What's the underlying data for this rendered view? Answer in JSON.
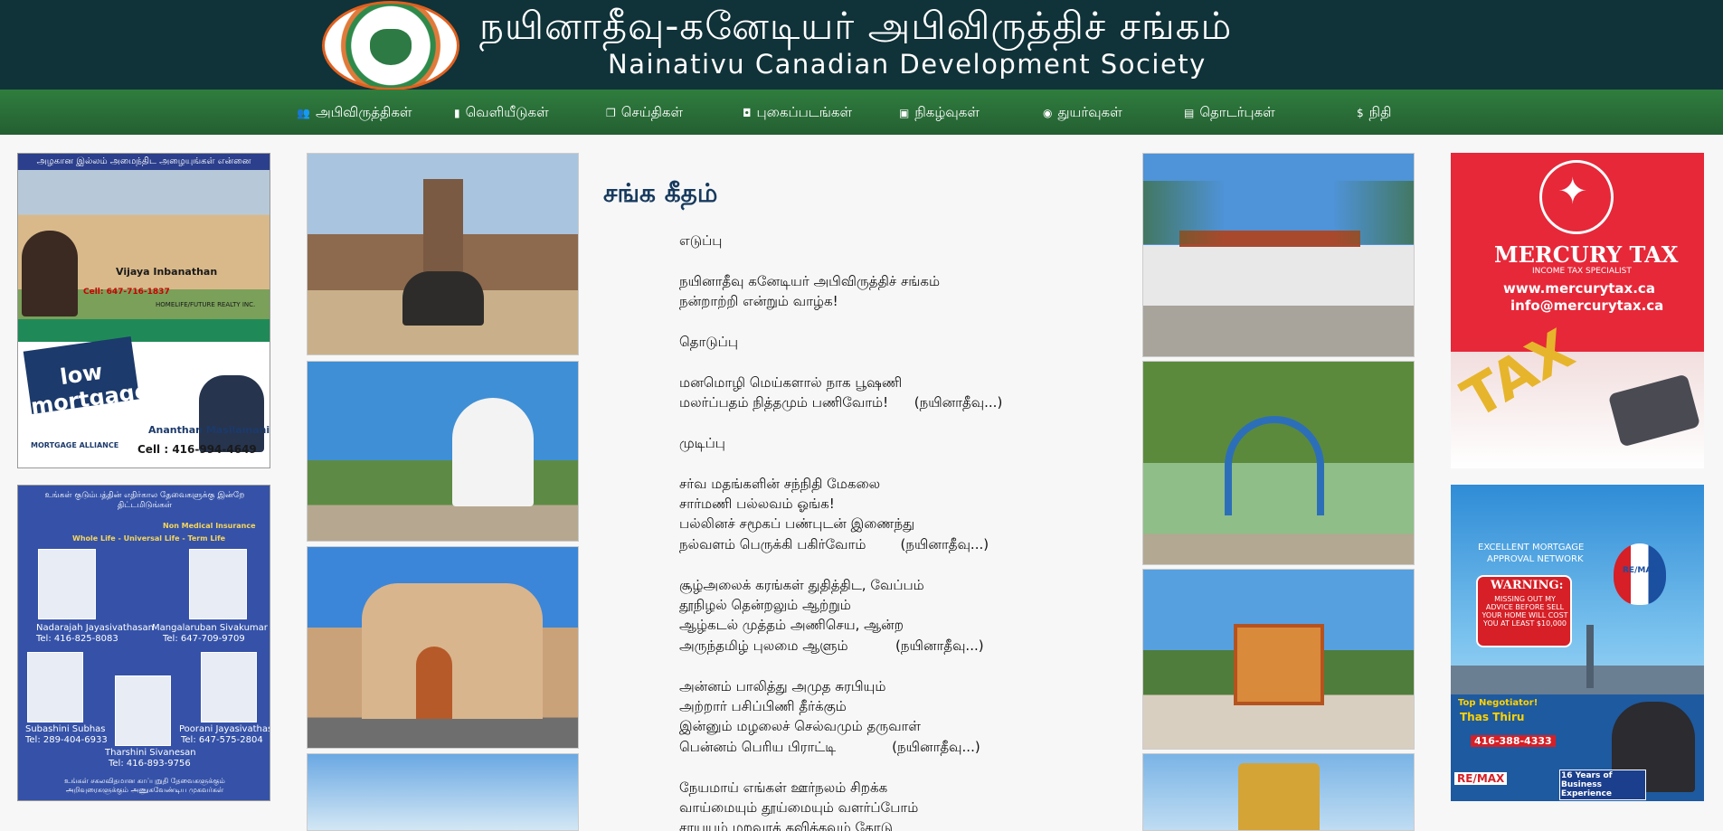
{
  "header": {
    "title_tamil": "நயினாதீவு-கனேடியர் அபிவிருத்திச் சங்கம்",
    "title_english": "Nainativu Canadian Development Society"
  },
  "nav": {
    "items": [
      {
        "icon": "users-icon",
        "label": "அபிவிருத்திகள்"
      },
      {
        "icon": "book-icon",
        "label": "வெளியீடுகள்"
      },
      {
        "icon": "news-icon",
        "label": "செய்திகள்"
      },
      {
        "icon": "camera-icon",
        "label": "புகைப்படங்கள்"
      },
      {
        "icon": "calendar-icon",
        "label": "நிகழ்வுகள்"
      },
      {
        "icon": "eye-icon",
        "label": "துயர்வுகள்"
      },
      {
        "icon": "contact-card-icon",
        "label": "தொடர்புகள்"
      },
      {
        "icon": "dollar-icon",
        "label": "நிதி"
      }
    ]
  },
  "ads": {
    "left_top": {
      "banner": "அழகான இல்லம் அமைந்திட அழையுங்கள் என்னை",
      "agent1_name": "Vijaya Inbanathan",
      "realty": "HOMELIFE/FUTURE REALTY INC.",
      "cell1": "Cell: 647-716-1837",
      "rates_text": "low mortgage RATES",
      "agent2_name": "Ananthan Masilamani",
      "cell2": "Cell : 416-994-4649",
      "brand": "MORTGAGE ALLIANCE"
    },
    "left_bottom": {
      "banner": "உங்கள் குடும்பத்தின் எதிர்கால தேவைகளுக்கு இன்றே திட்டமிடுங்கள்",
      "tagline": "Non Medical Insurance",
      "tagline2": "Whole Life - Universal Life - Term Life",
      "people": [
        {
          "name": "Nadarajah Jayasivathasan",
          "tel": "Tel: 416-825-8083"
        },
        {
          "name": "Mangalaruban Sivakumar",
          "tel": "Tel: 647-709-9709"
        },
        {
          "name": "Subashini Subhas",
          "tel": "Tel: 289-404-6933"
        },
        {
          "name": "Poorani Jayasivathasan",
          "tel": "Tel: 647-575-2804"
        },
        {
          "name": "Tharshini Sivanesan",
          "tel": "Tel: 416-893-9756"
        }
      ],
      "footer": "உங்கள் சகலவிதமான காப்புறுதி தேவைகளுக்கும் அறிவுரைகளுக்கும் அணுகவேண்டிய முகவர்கள்"
    },
    "right_top": {
      "brand": "MERCURY TAX",
      "sub": "INCOME TAX SPECIALIST",
      "web": "www.mercurytax.ca",
      "email": "info@mercurytax.ca",
      "art": "TAX"
    },
    "right_bottom": {
      "headline1": "EXCELLENT MORTGAGE",
      "headline2": "APPROVAL NETWORK",
      "warning_title": "WARNING:",
      "warning_text": "MISSING OUT MY ADVICE BEFORE SELL YOUR HOME WILL COST YOU AT LEAST $10,000",
      "top_neg": "Top Negotiator!",
      "agent": "Thas Thiru",
      "phone": "416-388-4333",
      "remax": "RE/MAX",
      "years": "16 Years of Business Experience"
    }
  },
  "poem": {
    "title": "சங்க கீதம்",
    "lines": [
      "எடுப்பு",
      "",
      "நயினாதீவு கனேடியர் அபிவிருத்திச் சங்கம்",
      "நன்றாற்றி என்றும் வாழ்க!",
      "",
      "தொடுப்பு",
      "",
      "மனமொழி மெய்களால் நாக பூஷணி",
      "மலர்ப்பதம் நித்தமும் பணிவோம்!      (நயினாதீவு...)",
      "",
      "முடிப்பு",
      "",
      "சர்வ மதங்களின் சந்நிதி மேகலை",
      "சார்மணி பல்லவம் ஓங்க!",
      "பல்லினச் சமூகப் பண்புடன் இணைந்து",
      "நல்வளம் பெருக்கி பகிர்வோம்        (நயினாதீவு...)",
      "",
      "சூழ்அலைக் கரங்கள் துதித்திட, வேப்பம்",
      "தூநிழல் தென்றலும் ஆற்றும்",
      "ஆழ்கடல் முத்தம் அணிசெய, ஆன்ற",
      "அருந்தமிழ் புலமை ஆளும்           (நயினாதீவு...)",
      "",
      "அன்னம் பாலித்து அமுத சுரபியும்",
      "அற்றார் பசிப்பிணி தீர்க்கும்",
      "இன்னும் மழலைச் செல்வமும் தருவாள்",
      "பென்னம் பெரிய பிராட்டி             (நயினாதீவு...)",
      "",
      "நேயமாய் எங்கள் ஊர்நலம் சிறக்க",
      "வாய்மையும் தூய்மையும் வளர்ப்போம்",
      "சரயுயும் மறவாக் கவிக்கவும் கோடு"
    ]
  },
  "photos": {
    "left": [
      "temple-photo",
      "stupa-photo",
      "church-photo",
      "shore-photo"
    ],
    "right": [
      "mosque-photo",
      "school-gate-photo",
      "arch-gate-photo",
      "gopuram-photo"
    ]
  }
}
